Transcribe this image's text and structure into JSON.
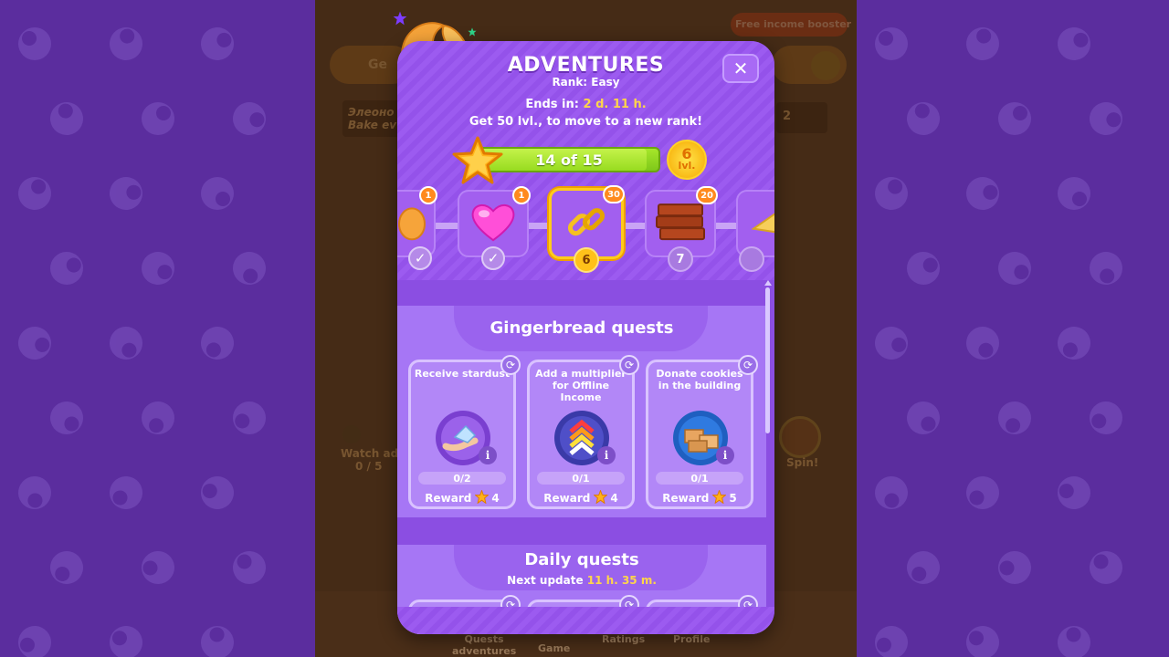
{
  "background": {
    "booster_label": "Free income booster",
    "bg_left_pill": "Ge",
    "bg_name_1": "Элеоно",
    "bg_name_2": "Bake ev",
    "bg_watch": "Watch ad",
    "bg_watch_count": "0 / 5",
    "bg_spin": "Spin!",
    "bg_counter": "2",
    "nav": [
      "Quests adventures",
      "Game",
      "Ratings",
      "Profile"
    ]
  },
  "modal": {
    "title": "ADVENTURES",
    "rank": "Rank: Easy",
    "ends_prefix": "Ends in:",
    "ends_value": "2 d. 11 h.",
    "get_prefix": "Get",
    "get_value": "50 lvl.",
    "get_suffix": ", to move to a new rank!",
    "close_label": "✕",
    "progress": {
      "label": "14 of 15",
      "current": 14,
      "total": 15
    },
    "level_badge": {
      "number": "6",
      "unit": "lvl."
    },
    "stages": [
      {
        "icon": "fortune-cookie-icon",
        "count": "1",
        "done": true
      },
      {
        "icon": "heart-icon",
        "count": "1",
        "done": true
      },
      {
        "icon": "chain-link-icon",
        "count": "30",
        "number": "6",
        "active": true
      },
      {
        "icon": "bricks-icon",
        "count": "20",
        "number": "7"
      },
      {
        "icon": "cheese-icon"
      }
    ]
  },
  "gingerbread": {
    "title": "Gingerbread quests",
    "cards": [
      {
        "title": "Receive stardust",
        "icon": "stardust-hand-icon",
        "progress": "0/2",
        "reward_label": "Reward",
        "reward": "4"
      },
      {
        "title": "Add a multiplier for Offline Income",
        "icon": "multiplier-chevrons-icon",
        "progress": "0/1",
        "reward_label": "Reward",
        "reward": "4"
      },
      {
        "title": "Donate cookies in the building",
        "icon": "cookie-boxes-icon",
        "progress": "0/1",
        "reward_label": "Reward",
        "reward": "5"
      }
    ]
  },
  "daily": {
    "title": "Daily quests",
    "next_prefix": "Next update",
    "next_value": "11 h. 35 m."
  },
  "colors": {
    "accent": "#ffd54a",
    "panel": "#8b4fe0",
    "progress": "#98dc20"
  }
}
